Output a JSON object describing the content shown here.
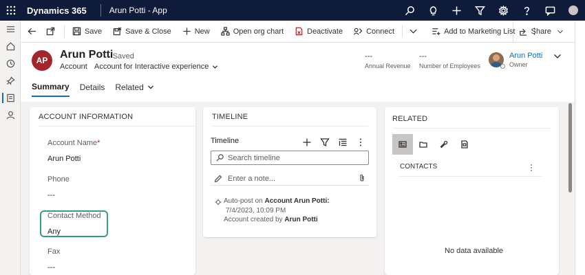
{
  "topbar": {
    "brand": "Dynamics 365",
    "app_name": "Arun Potti - App",
    "icons": [
      "search-icon",
      "lightbulb-icon",
      "plus-icon",
      "filter-icon",
      "gear-icon",
      "help-icon",
      "chat-icon",
      "user-avatar"
    ]
  },
  "rail": {
    "items": [
      "hamburger-icon",
      "home-icon",
      "recent-icon",
      "pin-icon",
      "accounts-icon",
      "contacts-icon"
    ]
  },
  "commands": {
    "save": "Save",
    "save_close": "Save & Close",
    "new": "New",
    "org_chart": "Open org chart",
    "deactivate": "Deactivate",
    "connect": "Connect",
    "marketing": "Add to Marketing List",
    "share": "Share"
  },
  "record": {
    "initials": "AP",
    "avatar_color": "#a4262c",
    "name": "Arun Potti",
    "saved_status": "- Saved",
    "entity": "Account",
    "form": "Account for Interactive experience",
    "annual_revenue_value": "---",
    "annual_revenue_label": "Annual Revenue",
    "employees_value": "---",
    "employees_label": "Number of Employees",
    "owner_name": "Arun Potti",
    "owner_label": "Owner"
  },
  "tabs": {
    "summary": "Summary",
    "details": "Details",
    "related": "Related"
  },
  "account_info": {
    "title": "ACCOUNT INFORMATION",
    "account_name_label": "Account Name",
    "required_marker": "*",
    "account_name_value": "Arun Potti",
    "phone_label": "Phone",
    "phone_value": "---",
    "contact_method_label": "Contact Method",
    "contact_method_value": "Any",
    "fax_label": "Fax",
    "fax_value": "---"
  },
  "timeline": {
    "title": "TIMELINE",
    "subtitle": "Timeline",
    "search_placeholder": "Search timeline",
    "note_placeholder": "Enter a note...",
    "post_prefix": "Auto-post on ",
    "post_subject": "Account Arun Potti:",
    "post_date": "7/4/2023, 10:09 PM",
    "post_body_prefix": "Account created by ",
    "post_author": "Arun Potti"
  },
  "related": {
    "title": "RELATED",
    "contacts_title": "CONTACTS",
    "empty_text": "No data available"
  },
  "colors": {
    "topbar": "#0e1b3b",
    "accent": "#0f6cbd",
    "highlight": "#2ea37a"
  }
}
